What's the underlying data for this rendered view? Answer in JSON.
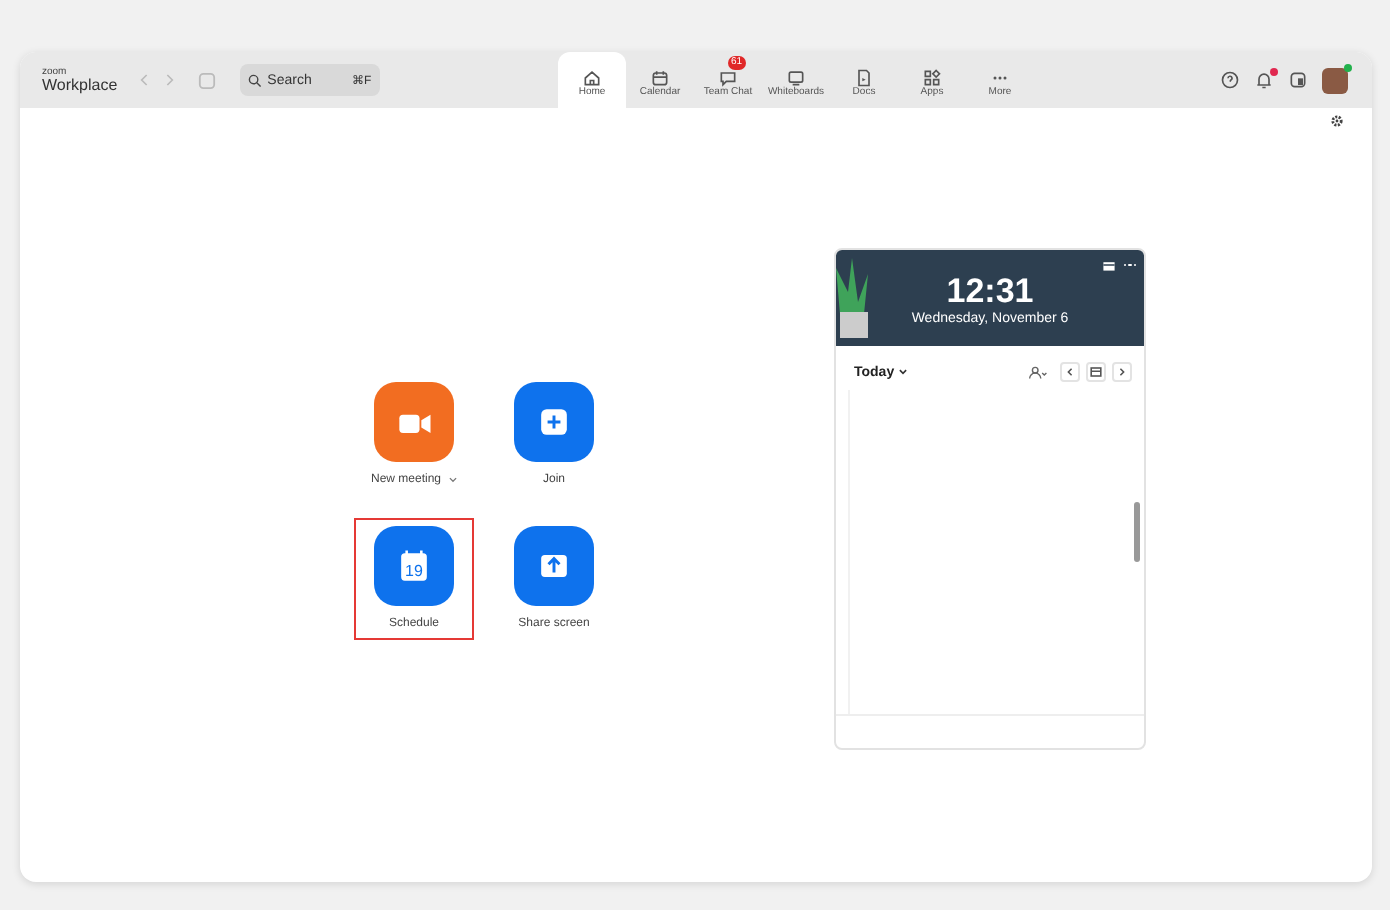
{
  "brand": {
    "small": "zoom",
    "name": "Workplace"
  },
  "search": {
    "placeholder": "Search",
    "shortcut": "⌘F"
  },
  "tabs": [
    {
      "label": "Home",
      "selected": true
    },
    {
      "label": "Calendar",
      "selected": false
    },
    {
      "label": "Team Chat",
      "selected": false,
      "badge": "61"
    },
    {
      "label": "Whiteboards",
      "selected": false
    },
    {
      "label": "Docs",
      "selected": false
    },
    {
      "label": "Apps",
      "selected": false
    },
    {
      "label": "More",
      "selected": false
    }
  ],
  "notifications": {
    "unread": true
  },
  "actions": [
    {
      "kind": "video",
      "label": "New meeting",
      "dropdown": true,
      "highlighted": false
    },
    {
      "kind": "join",
      "label": "Join",
      "dropdown": false,
      "highlighted": false
    },
    {
      "kind": "schedule",
      "label": "Schedule",
      "day": "19",
      "dropdown": false,
      "highlighted": true
    },
    {
      "kind": "share",
      "label": "Share screen",
      "dropdown": false,
      "highlighted": false
    }
  ],
  "calendar_widget": {
    "time": "12:31",
    "date": "Wednesday, November 6",
    "view": "Today"
  }
}
